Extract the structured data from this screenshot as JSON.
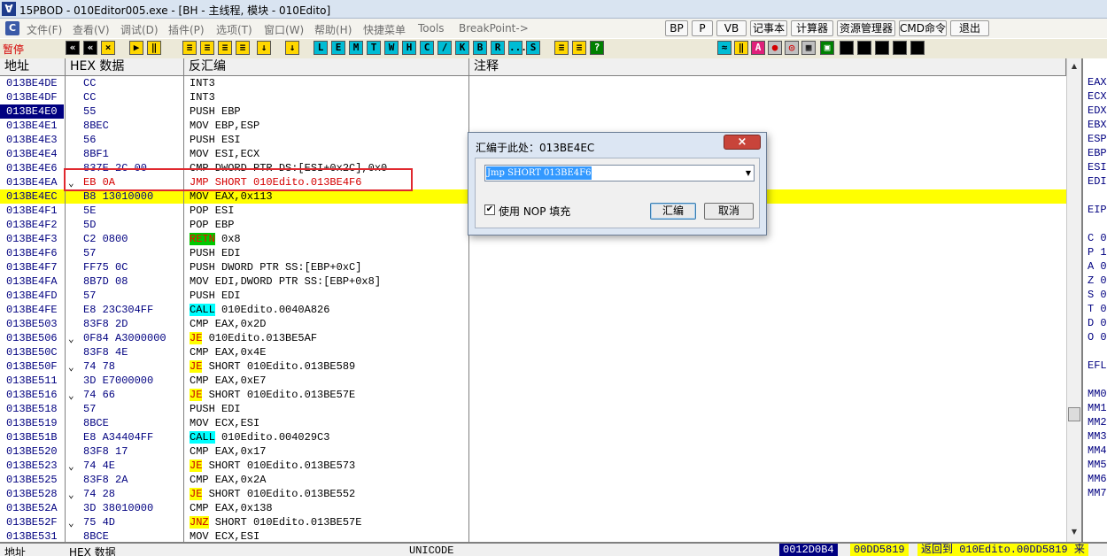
{
  "window": {
    "title": "15PBOD - 010Editor005.exe - [BH - 主线程, 模块 - 010Edito]",
    "menus": [
      "文件(F)",
      "查看(V)",
      "调试(D)",
      "插件(P)",
      "选项(T)",
      "窗口(W)",
      "帮助(H)",
      "快捷菜单",
      "Tools",
      "BreakPoint->"
    ],
    "quick_buttons": [
      "BP",
      "P",
      "VB",
      "记事本",
      "计算器",
      "资源管理器",
      "CMD命令",
      "退出"
    ]
  },
  "toolbar": {
    "status": "暂停",
    "exec_buttons": [
      "«",
      "×",
      "▶",
      "‖",
      "≡",
      "≡",
      "≡",
      "≡",
      "↓"
    ],
    "view_buttons": [
      "L",
      "E",
      "M",
      "T",
      "W",
      "H",
      "C",
      "/",
      "K",
      "B",
      "R",
      "...",
      "S"
    ],
    "right_buttons": [
      "≈",
      "‖",
      "A",
      "●",
      "◎",
      "▦",
      "▣"
    ]
  },
  "columns": {
    "address": "地址",
    "hex": "HEX 数据",
    "disasm": "反汇编",
    "comment": "注释",
    "registers": "寄存"
  },
  "disasm_rows": [
    {
      "addr": "013BE4DE",
      "mark": "",
      "hex": "CC",
      "parts": [
        {
          "t": "INT3"
        }
      ]
    },
    {
      "addr": "013BE4DF",
      "mark": "",
      "hex": "CC",
      "parts": [
        {
          "t": "INT3"
        }
      ]
    },
    {
      "addr": "013BE4E0",
      "mark": "",
      "hex": "55",
      "parts": [
        {
          "t": "PUSH EBP"
        }
      ],
      "addr_selected": true
    },
    {
      "addr": "013BE4E1",
      "mark": "",
      "hex": "8BEC",
      "parts": [
        {
          "t": "MOV EBP,ESP"
        }
      ]
    },
    {
      "addr": "013BE4E3",
      "mark": "",
      "hex": "56",
      "parts": [
        {
          "t": "PUSH ESI"
        }
      ]
    },
    {
      "addr": "013BE4E4",
      "mark": "",
      "hex": "8BF1",
      "parts": [
        {
          "t": "MOV ESI,ECX"
        }
      ]
    },
    {
      "addr": "013BE4E6",
      "mark": "",
      "hex": "837E 2C 00",
      "parts": [
        {
          "t": "CMP DWORD PTR DS:[ESI+0x2C],0x0"
        }
      ]
    },
    {
      "addr": "013BE4EA",
      "mark": "⌄",
      "hex": "EB 0A",
      "parts": [
        {
          "t": "JMP SHORT 010Edito.013BE4F6"
        }
      ],
      "red": true
    },
    {
      "addr": "013BE4EC",
      "mark": "",
      "hex": "B8 13010000",
      "parts": [
        {
          "t": "MOV EAX,0x113"
        }
      ],
      "current": true
    },
    {
      "addr": "013BE4F1",
      "mark": "",
      "hex": "5E",
      "parts": [
        {
          "t": "POP ESI"
        }
      ]
    },
    {
      "addr": "013BE4F2",
      "mark": "",
      "hex": "5D",
      "parts": [
        {
          "t": "POP EBP"
        }
      ]
    },
    {
      "addr": "013BE4F3",
      "mark": "",
      "hex": "C2 0800",
      "parts": [
        {
          "t": "RETN",
          "k": "retn"
        },
        {
          "t": " 0x8"
        }
      ]
    },
    {
      "addr": "013BE4F6",
      "mark": "",
      "hex": "57",
      "parts": [
        {
          "t": "PUSH EDI"
        }
      ]
    },
    {
      "addr": "013BE4F7",
      "mark": "",
      "hex": "FF75 0C",
      "parts": [
        {
          "t": "PUSH DWORD PTR SS:[EBP+0xC]"
        }
      ]
    },
    {
      "addr": "013BE4FA",
      "mark": "",
      "hex": "8B7D 08",
      "parts": [
        {
          "t": "MOV EDI,DWORD PTR SS:[EBP+0x8]"
        }
      ]
    },
    {
      "addr": "013BE4FD",
      "mark": "",
      "hex": "57",
      "parts": [
        {
          "t": "PUSH EDI"
        }
      ]
    },
    {
      "addr": "013BE4FE",
      "mark": "",
      "hex": "E8 23C304FF",
      "parts": [
        {
          "t": "CALL",
          "k": "call"
        },
        {
          "t": " 010Edito.0040A826"
        }
      ]
    },
    {
      "addr": "013BE503",
      "mark": "",
      "hex": "83F8 2D",
      "parts": [
        {
          "t": "CMP EAX,0x2D"
        }
      ]
    },
    {
      "addr": "013BE506",
      "mark": "⌄",
      "hex": "0F84 A3000000",
      "parts": [
        {
          "t": "JE",
          "k": "jcc"
        },
        {
          "t": " 010Edito.013BE5AF"
        }
      ]
    },
    {
      "addr": "013BE50C",
      "mark": "",
      "hex": "83F8 4E",
      "parts": [
        {
          "t": "CMP EAX,0x4E"
        }
      ]
    },
    {
      "addr": "013BE50F",
      "mark": "⌄",
      "hex": "74 78",
      "parts": [
        {
          "t": "JE",
          "k": "jcc"
        },
        {
          "t": " SHORT 010Edito.013BE589"
        }
      ]
    },
    {
      "addr": "013BE511",
      "mark": "",
      "hex": "3D E7000000",
      "parts": [
        {
          "t": "CMP EAX,0xE7"
        }
      ]
    },
    {
      "addr": "013BE516",
      "mark": "⌄",
      "hex": "74 66",
      "parts": [
        {
          "t": "JE",
          "k": "jcc"
        },
        {
          "t": " SHORT 010Edito.013BE57E"
        }
      ]
    },
    {
      "addr": "013BE518",
      "mark": "",
      "hex": "57",
      "parts": [
        {
          "t": "PUSH EDI"
        }
      ]
    },
    {
      "addr": "013BE519",
      "mark": "",
      "hex": "8BCE",
      "parts": [
        {
          "t": "MOV ECX,ESI"
        }
      ]
    },
    {
      "addr": "013BE51B",
      "mark": "",
      "hex": "E8 A34404FF",
      "parts": [
        {
          "t": "CALL",
          "k": "call"
        },
        {
          "t": " 010Edito.004029C3"
        }
      ]
    },
    {
      "addr": "013BE520",
      "mark": "",
      "hex": "83F8 17",
      "parts": [
        {
          "t": "CMP EAX,0x17"
        }
      ]
    },
    {
      "addr": "013BE523",
      "mark": "⌄",
      "hex": "74 4E",
      "parts": [
        {
          "t": "JE",
          "k": "jcc"
        },
        {
          "t": " SHORT 010Edito.013BE573"
        }
      ]
    },
    {
      "addr": "013BE525",
      "mark": "",
      "hex": "83F8 2A",
      "parts": [
        {
          "t": "CMP EAX,0x2A"
        }
      ]
    },
    {
      "addr": "013BE528",
      "mark": "⌄",
      "hex": "74 28",
      "parts": [
        {
          "t": "JE",
          "k": "jcc"
        },
        {
          "t": " SHORT 010Edito.013BE552"
        }
      ]
    },
    {
      "addr": "013BE52A",
      "mark": "",
      "hex": "3D 38010000",
      "parts": [
        {
          "t": "CMP EAX,0x138"
        }
      ]
    },
    {
      "addr": "013BE52F",
      "mark": "⌄",
      "hex": "75 4D",
      "parts": [
        {
          "t": "JNZ",
          "k": "jcc"
        },
        {
          "t": " SHORT 010Edito.013BE57E"
        }
      ]
    },
    {
      "addr": "013BE531",
      "mark": "",
      "hex": "8BCE",
      "parts": [
        {
          "t": "MOV ECX,ESI"
        }
      ]
    }
  ],
  "registers": [
    "EAX",
    "ECX",
    "EDX",
    "EBX",
    "ESP",
    "EBP",
    "ESI",
    "EDI",
    "",
    "EIP",
    "",
    "C 0",
    "P 1",
    "A 0",
    "Z 0",
    "S 0",
    "T 0",
    "D 0",
    "O 0",
    "",
    "EFL",
    "",
    "MM0",
    "MM1",
    "MM2",
    "MM3",
    "MM4",
    "MM5",
    "MM6",
    "MM7"
  ],
  "dialog": {
    "title": "汇编于此处：013BE4EC",
    "close": "×",
    "instruction": "Jmp SHORT 013BE4F6",
    "checkbox_label": "使用 NOP 填充",
    "checkbox_mark": "✔",
    "checked": true,
    "assemble_button": "汇编",
    "cancel_button": "取消"
  },
  "bottom": {
    "address": "地址",
    "hex": "HEX 数据",
    "unicode": "UNICODE",
    "stack_addr": "0012D0B4",
    "stack_value": "00DD5819",
    "stack_comment": "返回到 010Edito.00DD5819 来"
  }
}
